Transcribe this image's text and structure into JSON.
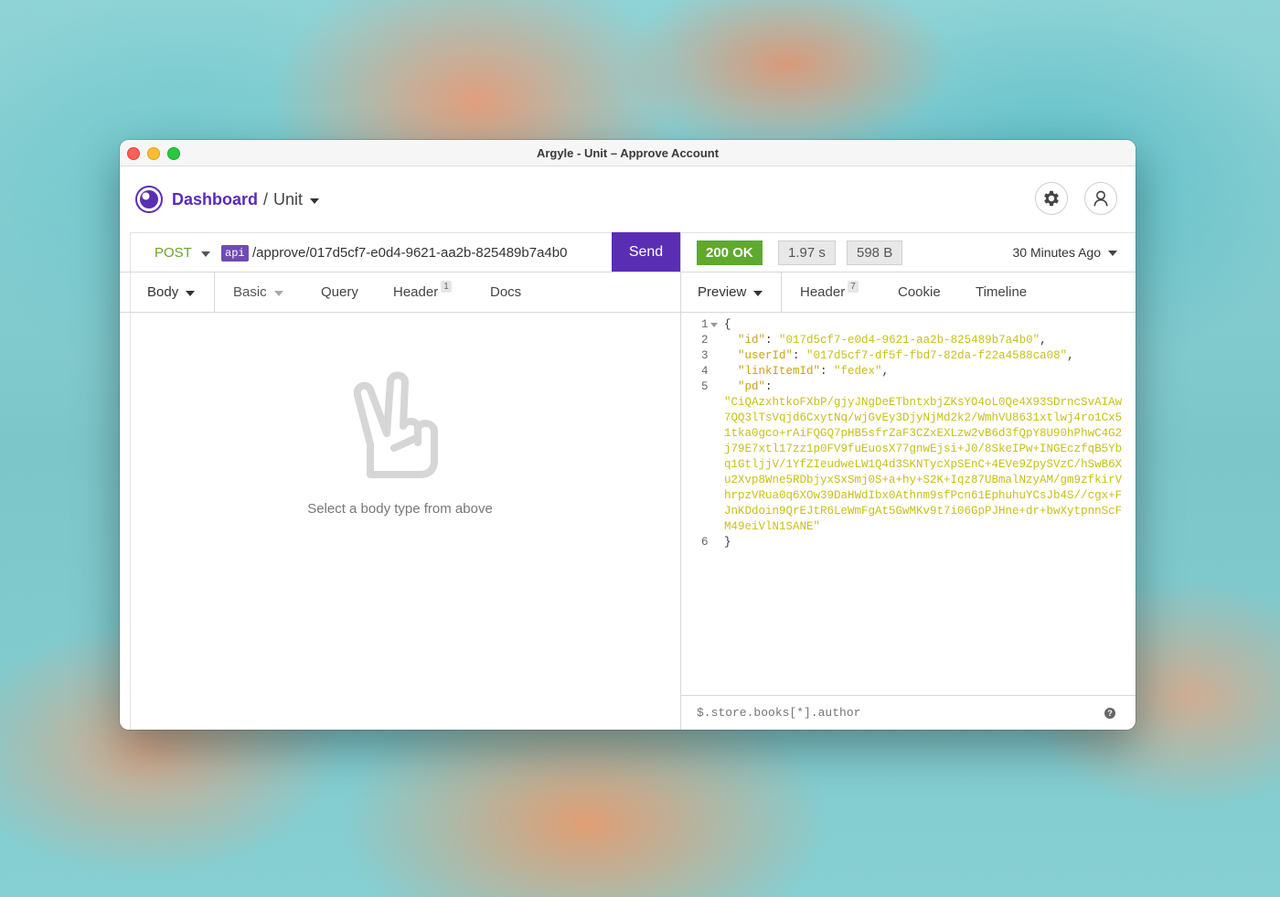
{
  "window": {
    "title": "Argyle - Unit – Approve Account"
  },
  "header": {
    "breadcrumb_root": "Dashboard",
    "breadcrumb_sep": "/",
    "breadcrumb_current": "Unit"
  },
  "request": {
    "method": "POST",
    "env_tag": "api",
    "url": "/approve/017d5cf7-e0d4-9621-aa2b-825489b7a4b0",
    "send_label": "Send",
    "tabs": {
      "body": "Body",
      "basic": "Basic",
      "query": "Query",
      "header": "Header",
      "header_count": "1",
      "docs": "Docs"
    },
    "empty_message": "Select a body type from above"
  },
  "response": {
    "status": "200 OK",
    "time": "1.97 s",
    "size": "598 B",
    "ago": "30 Minutes Ago",
    "tabs": {
      "preview": "Preview",
      "header": "Header",
      "header_count": "7",
      "cookie": "Cookie",
      "timeline": "Timeline"
    },
    "lines": {
      "n1": "1",
      "n2": "2",
      "n3": "3",
      "n4": "4",
      "n5": "5",
      "n6": "6",
      "open": "{",
      "close": "}",
      "id_key": "\"id\"",
      "id_val": "\"017d5cf7-e0d4-9621-aa2b-825489b7a4b0\"",
      "userId_key": "\"userId\"",
      "userId_val": "\"017d5cf7-df5f-fbd7-82da-f22a4588ca08\"",
      "linkItemId_key": "\"linkItemId\"",
      "linkItemId_val": "\"fedex\"",
      "pd_key": "\"pd\"",
      "pd_val": [
        "\"CiQAzxhtkoFXbP/gjyJNgDeETbntxbjZKsYO4oL0Qe4X93SDrncSvAIAw",
        "7QQ3lTsVqjd6CxytNq/wjGvEy3DjyNjMd2k2/WmhVU8631xtlwj4ro1Cx5",
        "1tka0gco+rAiFQGQ7pHB5sfrZaF3CZxEXLzw2vB6d3fQpY8U90hPhwC4G2",
        "j79E7xtl17zz1p0FV9fuEuosX77gnwEjsi+J0/8SkeIPw+INGEczfqB5Yb",
        "q1GtljjV/1YfZIeudweLW1Q4d3SKNTycXpSEnC+4EVe9ZpySVzC/hSwB6X",
        "u2Xvp8Wne5RDbjyxSxSmj0S+a+hy+S2K+Iqz87UBmalNzyAM/gm9zfkirV",
        "hrpzVRua0q6XOw39DaHWdIbx0Athnm9sfPcn61EphuhuYCsJb4S//cgx+F",
        "JnKDdoin9QrEJtR6LeWmFgAt5GwMKv9t7i06GpPJHne+dr+bwXytpnnScF",
        "M49eiVlN1SANE\""
      ]
    },
    "filter_placeholder": "$.store.books[*].author",
    "help_glyph": "?"
  },
  "colors": {
    "accent": "#5a2eb3",
    "ok": "#5fa92e",
    "method": "#6ba32a",
    "string": "#c8bf17"
  }
}
